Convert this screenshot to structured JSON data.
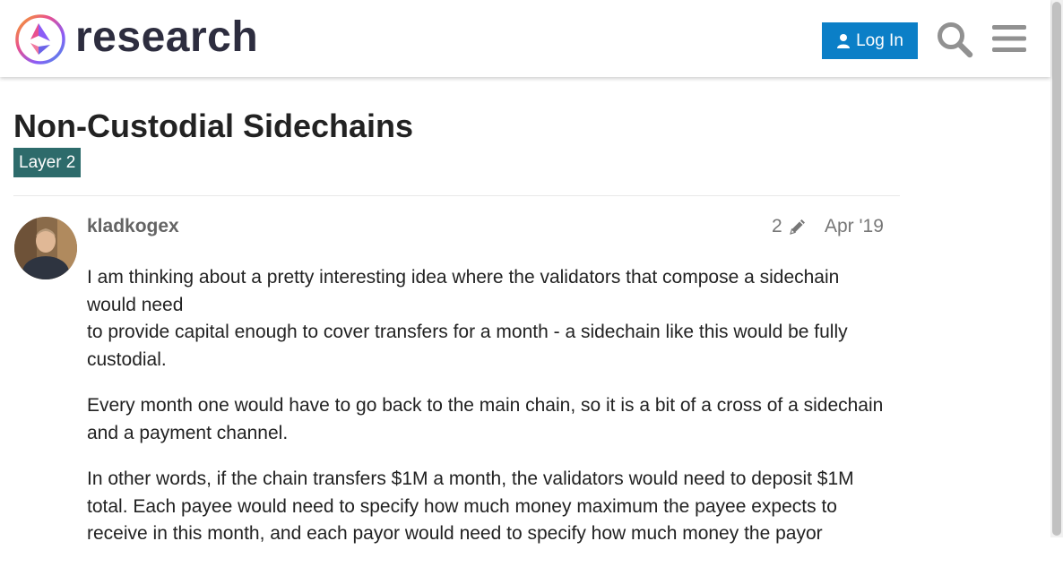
{
  "header": {
    "site_name": "research",
    "login_label": "Log In"
  },
  "topic": {
    "title": "Non-Custodial Sidechains",
    "category": "Layer 2"
  },
  "post": {
    "username": "kladkogex",
    "edit_count": "2",
    "date": "Apr '19",
    "paragraphs": [
      "I am thinking about a pretty interesting idea where the validators that compose a sidechain would need",
      "to provide capital enough to cover transfers for a month - a sidechain like this would be fully custodial.",
      "Every month one would have to go back to the main chain, so it is a bit of a cross of a sidechain and a payment channel.",
      "In other words, if the chain transfers $1M a month, the validators would need to deposit $1M total. Each payee would need to specify how much money maximum the payee expects to receive in this month, and each payor would need to specify how much money the payor"
    ]
  },
  "colors": {
    "login_button": "#0b7fc7",
    "category_badge": "#2d6b6b"
  }
}
